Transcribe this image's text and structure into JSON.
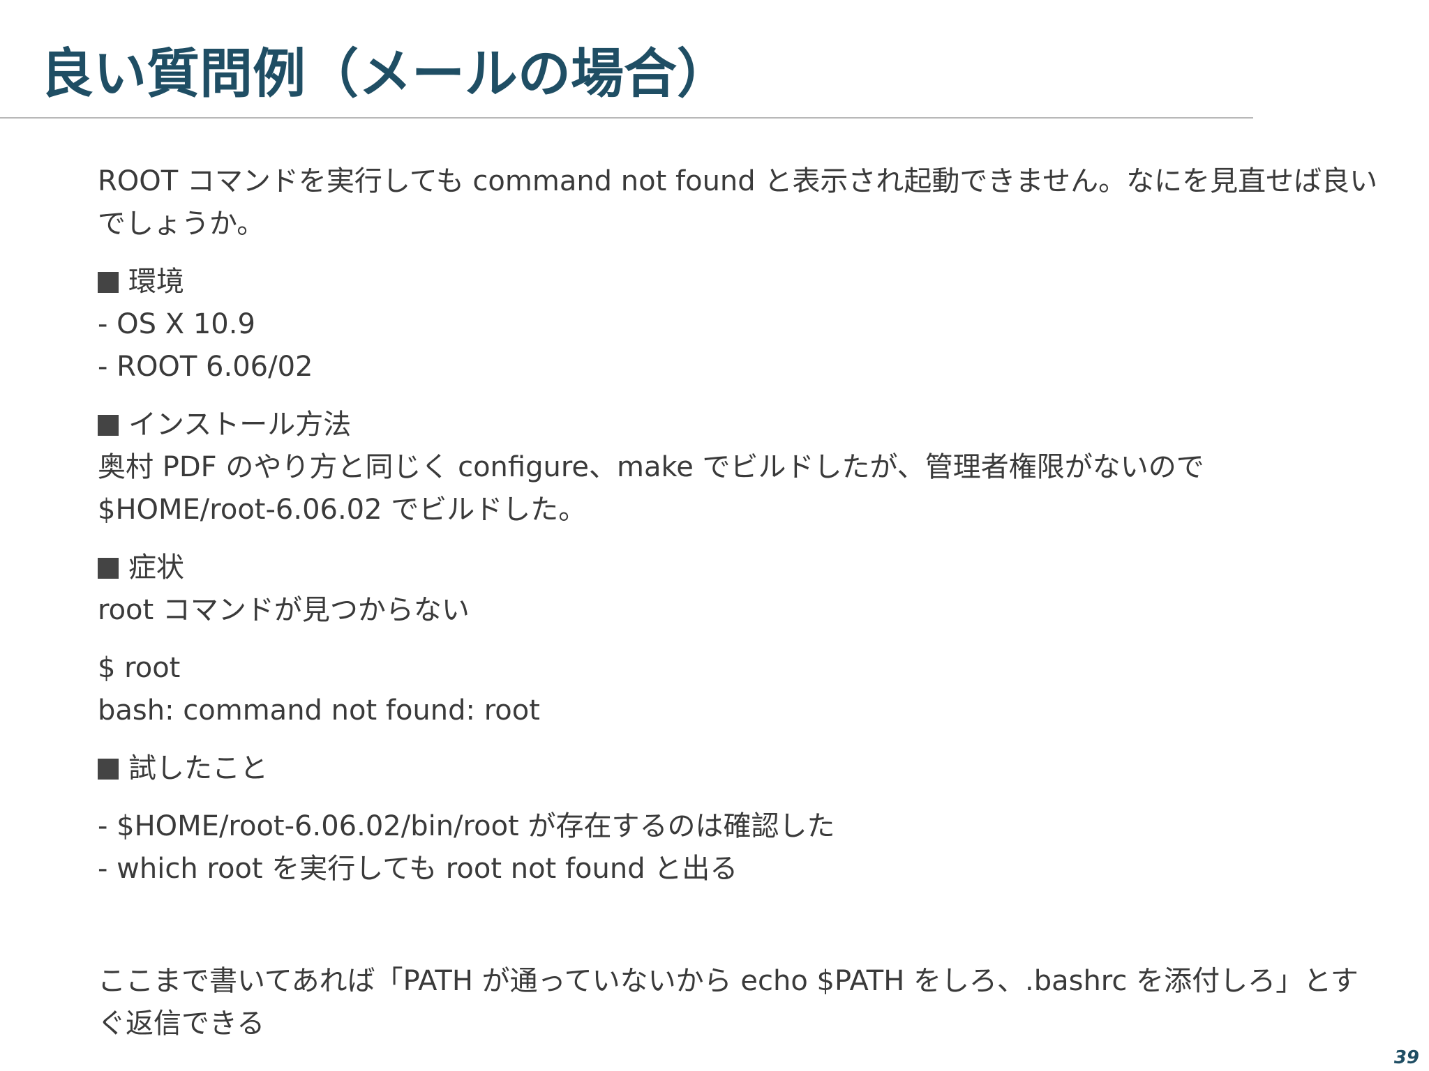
{
  "title": "良い質問例（メールの場合）",
  "intro": "ROOT コマンドを実行しても command not found と表示され起動できません。なにを見直せば良いでしょうか。",
  "sections": {
    "env": {
      "heading": "環境",
      "lines": [
        "- OS X 10.9",
        "- ROOT 6.06/02"
      ]
    },
    "install": {
      "heading": "インストール方法",
      "text": "奥村 PDF のやり方と同じく configure、make でビルドしたが、管理者権限がないので $HOME/root-6.06.02 でビルドした。"
    },
    "symptom": {
      "heading": "症状",
      "text": "root コマンドが見つからない",
      "console": [
        "$ root",
        "bash: command not found: root"
      ]
    },
    "tried": {
      "heading": "試したこと",
      "lines": [
        "- $HOME/root-6.06.02/bin/root が存在するのは確認した",
        "- which root を実行しても root not found と出る"
      ]
    }
  },
  "conclusion": "ここまで書いてあれば「PATH が通っていないから echo $PATH をしろ、.bashrc を添付しろ」とすぐ返信できる",
  "page_number": "39",
  "colors": {
    "title": "#1f4e64",
    "body_text": "#3a3a3a",
    "rule": "#b8b8b8",
    "bullet_square": "#444444"
  },
  "icons": {
    "bullet": "filled-square"
  }
}
